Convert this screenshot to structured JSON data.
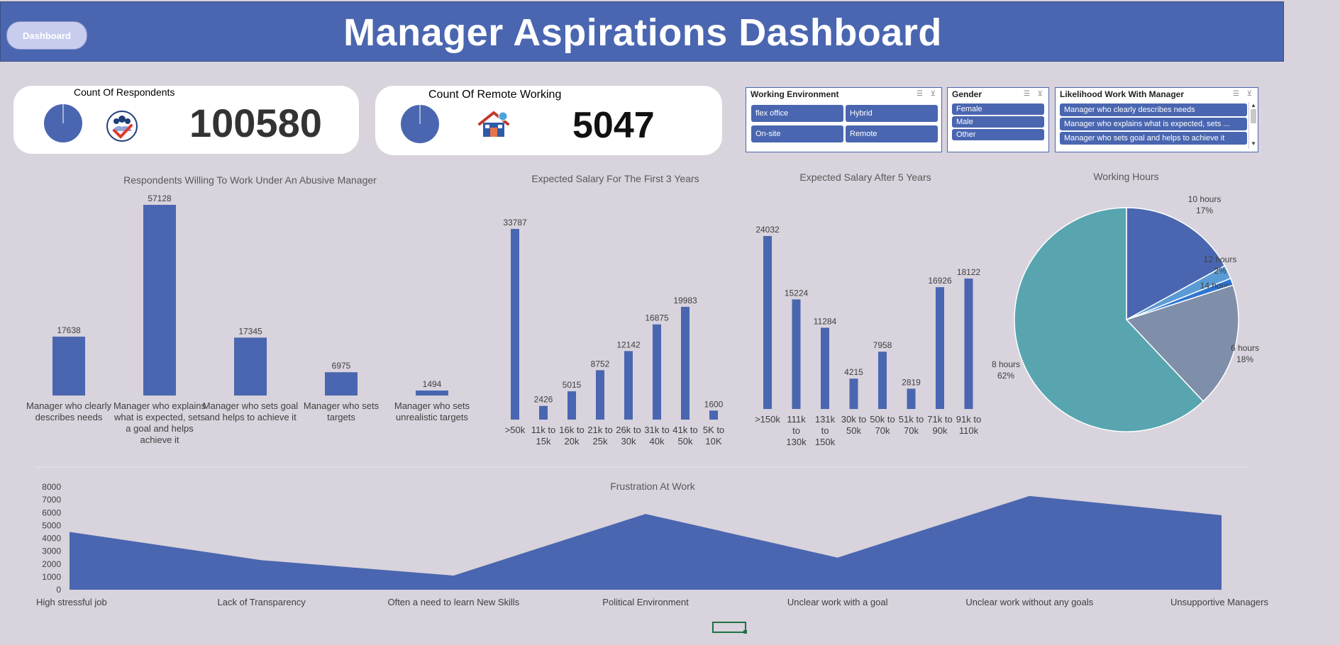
{
  "header": {
    "title": "Manager Aspirations Dashboard",
    "dashboard_button": "Dashboard"
  },
  "kpis": [
    {
      "title": "Count Of Respondents",
      "value": "100580",
      "icon": "people-check-icon"
    },
    {
      "title": "Count Of Remote Working",
      "value": "5047",
      "icon": "remote-house-icon"
    }
  ],
  "slicers": {
    "working_environment": {
      "title": "Working Environment",
      "items": [
        "flex office",
        "Hybrid",
        "On-site",
        "Remote"
      ]
    },
    "gender": {
      "title": "Gender",
      "items": [
        "Female",
        "Male",
        "Other"
      ]
    },
    "likelihood": {
      "title": "Likelihood Work With Manager",
      "items": [
        "Manager who clearly describes needs",
        "Manager who explains what is expected, sets ...",
        "Manager who sets goal and helps to achieve it"
      ]
    }
  },
  "colors": {
    "bar": "#4a66b0",
    "header": "#4a66b0",
    "background": "#d8d3dc"
  },
  "chart_data": [
    {
      "type": "bar",
      "title": "Respondents Willing To Work Under An Abusive Manager",
      "categories": [
        "Manager who clearly describes needs",
        "Manager who explains what is expected, sets a goal and helps achieve it",
        "Manager who sets goal and helps to achieve it",
        "Manager who sets targets",
        "Manager who sets unrealistic targets"
      ],
      "category_lines": [
        [
          "Manager who clearly",
          "describes needs"
        ],
        [
          "Manager who explains",
          "what is expected, sets",
          "a goal and helps",
          "achieve it"
        ],
        [
          "Manager who sets goal",
          "and helps to achieve it"
        ],
        [
          "Manager who sets",
          "targets"
        ],
        [
          "Manager who sets",
          "unrealistic targets"
        ]
      ],
      "values": [
        17638,
        57128,
        17345,
        6975,
        1494
      ],
      "data_labels": [
        "17638",
        "57128",
        "17345",
        "6975",
        "1494"
      ]
    },
    {
      "type": "bar",
      "title": "Expected Salary For The First 3 Years",
      "categories": [
        ">50k",
        "11k to 15k",
        "16k to 20k",
        "21k to 25k",
        "26k to 30k",
        "31k to 40k",
        "41k to 50k",
        "5K to 10K"
      ],
      "category_lines": [
        [
          ">50k"
        ],
        [
          "11k to",
          "15k"
        ],
        [
          "16k to",
          "20k"
        ],
        [
          "21k to",
          "25k"
        ],
        [
          "26k to",
          "30k"
        ],
        [
          "31k to",
          "40k"
        ],
        [
          "41k to",
          "50k"
        ],
        [
          "5K to",
          "10K"
        ]
      ],
      "values": [
        33787,
        2426,
        5015,
        8752,
        12142,
        16875,
        19983,
        1600
      ],
      "data_labels": [
        "33787",
        "2426",
        "5015",
        "8752",
        "12142",
        "16875",
        "19983",
        "1600"
      ]
    },
    {
      "type": "bar",
      "title": "Expected Salary After 5 Years",
      "categories": [
        ">150k",
        "111k to 130k",
        "131k to 150k",
        "30k to 50k",
        "50k to 70k",
        "51k to 70k",
        "71k to 90k",
        "91k to 110k"
      ],
      "category_lines": [
        [
          ">150k"
        ],
        [
          "111k",
          "to",
          "130k"
        ],
        [
          "131k",
          "to",
          "150k"
        ],
        [
          "30k to",
          "50k"
        ],
        [
          "50k to",
          "70k"
        ],
        [
          "51k to",
          "70k"
        ],
        [
          "71k to",
          "90k"
        ],
        [
          "91k to",
          "110k"
        ]
      ],
      "values": [
        24032,
        15224,
        11284,
        4215,
        7958,
        2819,
        16926,
        18122
      ],
      "data_labels": [
        "24032",
        "15224",
        "11284",
        "4215",
        "7958",
        "2819",
        "16926",
        "18122"
      ]
    },
    {
      "type": "pie",
      "title": "Working Hours",
      "slices": [
        {
          "label": "10 hours",
          "percent_label": "17%",
          "value": 17,
          "color": "#4a66b0"
        },
        {
          "label": "12 hours",
          "percent_label": "2%",
          "value": 2,
          "color": "#5b9bd5"
        },
        {
          "label": "14 hours",
          "percent_label": "1%",
          "value": 1,
          "color": "#2e75d2"
        },
        {
          "label": "6 hours",
          "percent_label": "18%",
          "value": 18,
          "color": "#7f8fa9"
        },
        {
          "label": "8 hours",
          "percent_label": "62%",
          "value": 62,
          "color": "#58a5b0"
        }
      ]
    },
    {
      "type": "area",
      "title": "Frustration At Work",
      "categories": [
        "High stressful job",
        "Lack of Transparency",
        "Often a need to learn New Skills",
        "Political Environment",
        "Unclear work with a goal",
        "Unclear work without any goals",
        "Unsupportive Managers"
      ],
      "values": [
        4500,
        2300,
        1100,
        5900,
        2500,
        7300,
        5800
      ],
      "ylim": [
        0,
        8000
      ],
      "yticks": [
        "0",
        "1000",
        "2000",
        "3000",
        "4000",
        "5000",
        "6000",
        "7000",
        "8000"
      ]
    }
  ]
}
